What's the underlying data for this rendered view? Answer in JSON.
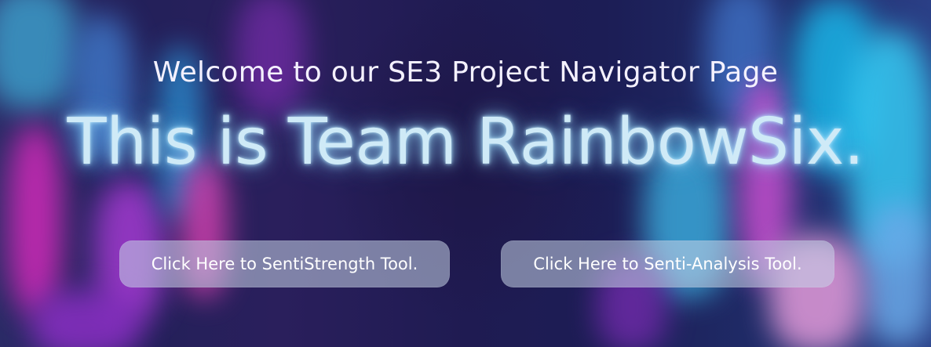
{
  "header": {
    "welcome": "Welcome to our SE3 Project Navigator Page",
    "team": "This is Team RainbowSix."
  },
  "buttons": {
    "sentistrength": "Click Here to SentiStrength Tool.",
    "senti_analysis": "Click Here to Senti-Analysis Tool."
  },
  "colors": {
    "background": "#1c1a4a",
    "glow_text": "#cfeaf7",
    "button_bg": "#c6d4e8"
  }
}
